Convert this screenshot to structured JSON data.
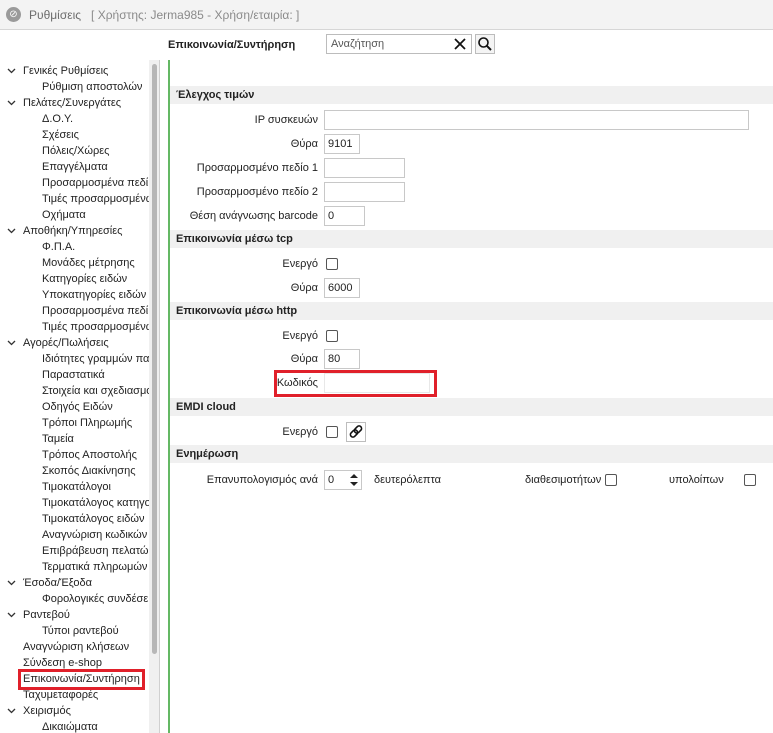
{
  "window": {
    "title": "Ρυθμίσεις",
    "user_info": "[ Χρήστης: Jerma985 - Χρήση/εταιρία:  ]"
  },
  "topbar": {
    "section_title": "Επικοινωνία/Συντήρηση",
    "search_placeholder": "Αναζήτηση"
  },
  "sidebar": {
    "items": [
      {
        "label": "Γενικές Ρυθμίσεις",
        "level": 0,
        "expanded": true
      },
      {
        "label": "Ρύθμιση αποστολών",
        "level": 1
      },
      {
        "label": "Πελάτες/Συνεργάτες",
        "level": 0,
        "expanded": true
      },
      {
        "label": "Δ.Ο.Υ.",
        "level": 1
      },
      {
        "label": "Σχέσεις",
        "level": 1
      },
      {
        "label": "Πόλεις/Χώρες",
        "level": 1
      },
      {
        "label": "Επαγγέλματα",
        "level": 1
      },
      {
        "label": "Προσαρμοσμένα πεδί",
        "level": 1
      },
      {
        "label": "Τιμές προσαρμοσμένω",
        "level": 1
      },
      {
        "label": "Οχήματα",
        "level": 1
      },
      {
        "label": "Αποθήκη/Υπηρεσίες",
        "level": 0,
        "expanded": true
      },
      {
        "label": "Φ.Π.Α.",
        "level": 1
      },
      {
        "label": "Μονάδες μέτρησης",
        "level": 1
      },
      {
        "label": "Κατηγορίες ειδών",
        "level": 1
      },
      {
        "label": "Υποκατηγορίες ειδών",
        "level": 1
      },
      {
        "label": "Προσαρμοσμένα πεδί",
        "level": 1
      },
      {
        "label": "Τιμές προσαρμοσμένω",
        "level": 1
      },
      {
        "label": "Αγορές/Πωλήσεις",
        "level": 0,
        "expanded": true
      },
      {
        "label": "Ιδιότητες γραμμών πα",
        "level": 1
      },
      {
        "label": "Παραστατικά",
        "level": 1
      },
      {
        "label": "Στοιχεία και σχεδιασμό",
        "level": 1
      },
      {
        "label": "Οδηγός Ειδών",
        "level": 1
      },
      {
        "label": "Τρόποι Πληρωμής",
        "level": 1
      },
      {
        "label": "Ταμεία",
        "level": 1
      },
      {
        "label": "Τρόπος Αποστολής",
        "level": 1
      },
      {
        "label": "Σκοπός Διακίνησης",
        "level": 1
      },
      {
        "label": "Τιμοκατάλογοι",
        "level": 1
      },
      {
        "label": "Τιμοκατάλογος κατηγο",
        "level": 1
      },
      {
        "label": "Τιμοκατάλογος ειδών",
        "level": 1
      },
      {
        "label": "Αναγνώριση κωδικών",
        "level": 1
      },
      {
        "label": "Επιβράβευση πελατώ",
        "level": 1
      },
      {
        "label": "Τερματικά πληρωμών",
        "level": 1
      },
      {
        "label": "Έσοδα/Έξοδα",
        "level": 0,
        "expanded": true
      },
      {
        "label": "Φορολογικές συνδέσε",
        "level": 1
      },
      {
        "label": "Ραντεβού",
        "level": 0,
        "expanded": true
      },
      {
        "label": "Τύποι ραντεβού",
        "level": 1
      },
      {
        "label": "Αναγνώριση κλήσεων",
        "level": 0
      },
      {
        "label": "Σύνδεση e-shop",
        "level": 0
      },
      {
        "label": "Επικοινωνία/Συντήρηση",
        "level": 0,
        "selected": true
      },
      {
        "label": "Ταχυμεταφορές",
        "level": 0
      },
      {
        "label": "Χειρισμός",
        "level": 0,
        "expanded": true
      },
      {
        "label": "Δικαιώματα",
        "level": 1
      }
    ]
  },
  "content": {
    "price_check": {
      "header": "Έλεγχος τιμών",
      "ip_label": "IP συσκευών",
      "ip_value": "",
      "port_label": "Θύρα",
      "port_value": "9101",
      "custom1_label": "Προσαρμοσμένο πεδίο 1",
      "custom1_value": "",
      "custom2_label": "Προσαρμοσμένο πεδίο 2",
      "custom2_value": "",
      "barcode_label": "Θέση ανάγνωσης barcode",
      "barcode_value": "0"
    },
    "tcp": {
      "header": "Επικοινωνία μέσω tcp",
      "active_label": "Ενεργό",
      "port_label": "Θύρα",
      "port_value": "6000"
    },
    "http": {
      "header": "Επικοινωνία μέσω http",
      "active_label": "Ενεργό",
      "port_label": "Θύρα",
      "port_value": "80",
      "code_label": "Κωδικός",
      "code_value": ""
    },
    "emdi": {
      "header": "EMDI cloud",
      "active_label": "Ενεργό"
    },
    "update": {
      "header": "Ενημέρωση",
      "recalc_label": "Επανυπολογισμός ανά",
      "recalc_value": "0",
      "seconds_label": "δευτερόλεπτα",
      "availability_label": "διαθεσιμοτήτων",
      "balances_label": "υπολοίπων"
    }
  },
  "colors": {
    "highlight": "#e0202a",
    "content_border": "#64b864"
  }
}
